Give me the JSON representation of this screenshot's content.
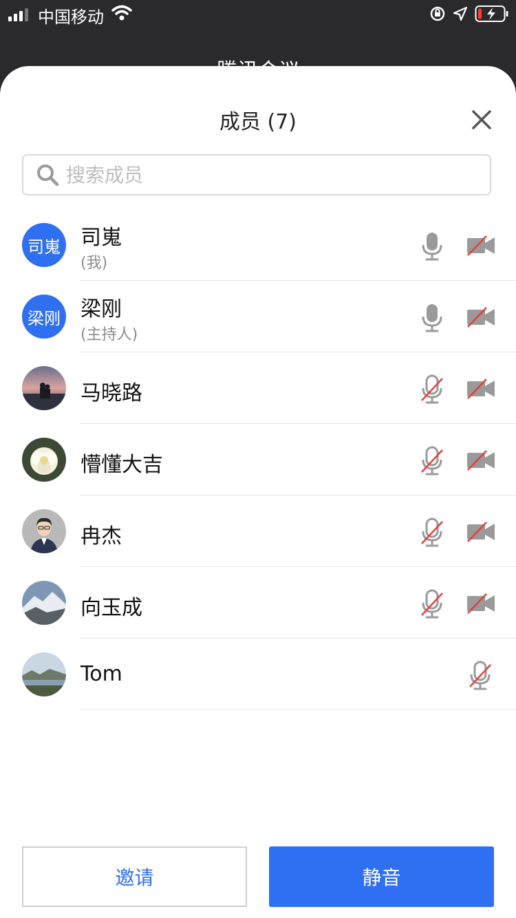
{
  "status_bar": {
    "carrier": "中国移动"
  },
  "background": {
    "title": "腾讯会议"
  },
  "sheet": {
    "title": "成员 (7)",
    "search_placeholder": "搜索成员"
  },
  "members": [
    {
      "name": "司嵬",
      "role": "(我)",
      "avatar_text": "司嵬",
      "mic": "on",
      "camera": "off"
    },
    {
      "name": "梁刚",
      "role": "(主持人)",
      "avatar_text": "梁刚",
      "mic": "on",
      "camera": "off"
    },
    {
      "name": "马晓路",
      "mic": "muted",
      "camera": "off"
    },
    {
      "name": "懵懂大吉",
      "mic": "muted",
      "camera": "off"
    },
    {
      "name": "冉杰",
      "mic": "muted",
      "camera": "off"
    },
    {
      "name": "向玉成",
      "mic": "muted",
      "camera": "off"
    },
    {
      "name": "Tom",
      "mic": "muted"
    }
  ],
  "buttons": {
    "invite": "邀请",
    "mute": "静音"
  },
  "colors": {
    "accent": "#2f6ff1",
    "muted_slash": "#e2403a",
    "icon_gray": "#9a9a9a"
  }
}
